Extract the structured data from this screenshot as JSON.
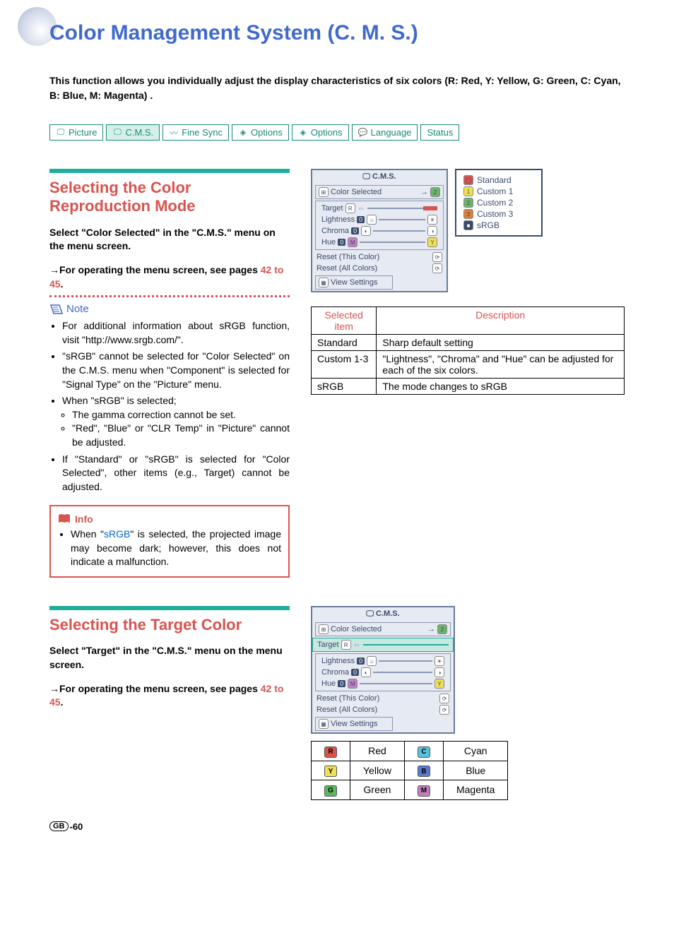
{
  "title": "Color Management System (C. M. S.)",
  "intro": "This function allows you individually adjust the display characteristics of six colors (R: Red, Y: Yellow, G: Green, C: Cyan, B: Blue, M: Magenta) .",
  "tabs": [
    "Picture",
    "C.M.S.",
    "Fine Sync",
    "Options",
    "Options",
    "Language",
    "Status"
  ],
  "section1": {
    "heading": "Selecting the Color Reproduction Mode",
    "select": "Select \"Color Selected\" in the \"C.M.S.\" menu on the menu screen.",
    "arrow_line_a": "For operating the menu screen, see pages ",
    "arrow_line_b": "42 to 45",
    "arrow_line_c": ".",
    "note_label": "Note",
    "notes": [
      "For additional information about sRGB function, visit \"http://www.srgb.com/\".",
      "\"sRGB\" cannot be selected for \"Color Selected\" on the C.M.S. menu when \"Component\" is selected for \"Signal Type\" on the \"Picture\" menu.",
      "When \"sRGB\" is selected;",
      "If \"Standard\" or \"sRGB\" is selected for \"Color Selected\", other items (e.g., Target) cannot be adjusted."
    ],
    "sub_notes": [
      "The gamma correction cannot be set.",
      "\"Red\", \"Blue\" or \"CLR Temp\" in \"Picture\" cannot be adjusted."
    ],
    "info_label": "Info",
    "info_a": "When \"",
    "info_b": "sRGB",
    "info_c": "\" is selected, the projected image may become dark; however, this does not indicate a malfunction."
  },
  "osd1": {
    "title": "C.M.S.",
    "color_selected": "Color Selected",
    "target": "Target",
    "lightness": "Lightness",
    "chroma": "Chroma",
    "hue": "Hue",
    "reset_this": "Reset (This Color)",
    "reset_all": "Reset (All Colors)",
    "view": "View Settings"
  },
  "popup_items": [
    "Standard",
    "Custom 1",
    "Custom 2",
    "Custom 3",
    "sRGB"
  ],
  "table1": {
    "h1": "Selected item",
    "h2": "Description",
    "rows": [
      [
        "Standard",
        "Sharp default setting"
      ],
      [
        "Custom 1-3",
        "\"Lightness\", \"Chroma\" and \"Hue\" can be adjusted for each of the six colors."
      ],
      [
        "sRGB",
        "The mode changes to sRGB"
      ]
    ]
  },
  "section2": {
    "heading": "Selecting the Target Color",
    "select": "Select \"Target\" in the \"C.M.S.\" menu on the menu screen.",
    "arrow_line_a": "For operating the menu screen, see pages ",
    "arrow_line_b": "42 to 45",
    "arrow_line_c": "."
  },
  "color_table": [
    {
      "chip": "R",
      "bg": "#d9534f",
      "name": "Red"
    },
    {
      "chip": "C",
      "bg": "#5bc0de",
      "name": "Cyan"
    },
    {
      "chip": "Y",
      "bg": "#f0e050",
      "name": "Yellow"
    },
    {
      "chip": "B",
      "bg": "#5a7ad0",
      "name": "Blue"
    },
    {
      "chip": "G",
      "bg": "#5cb85c",
      "name": "Green"
    },
    {
      "chip": "M",
      "bg": "#c080c0",
      "name": "Magenta"
    }
  ],
  "footer": {
    "gb": "GB",
    "page": "-60"
  }
}
